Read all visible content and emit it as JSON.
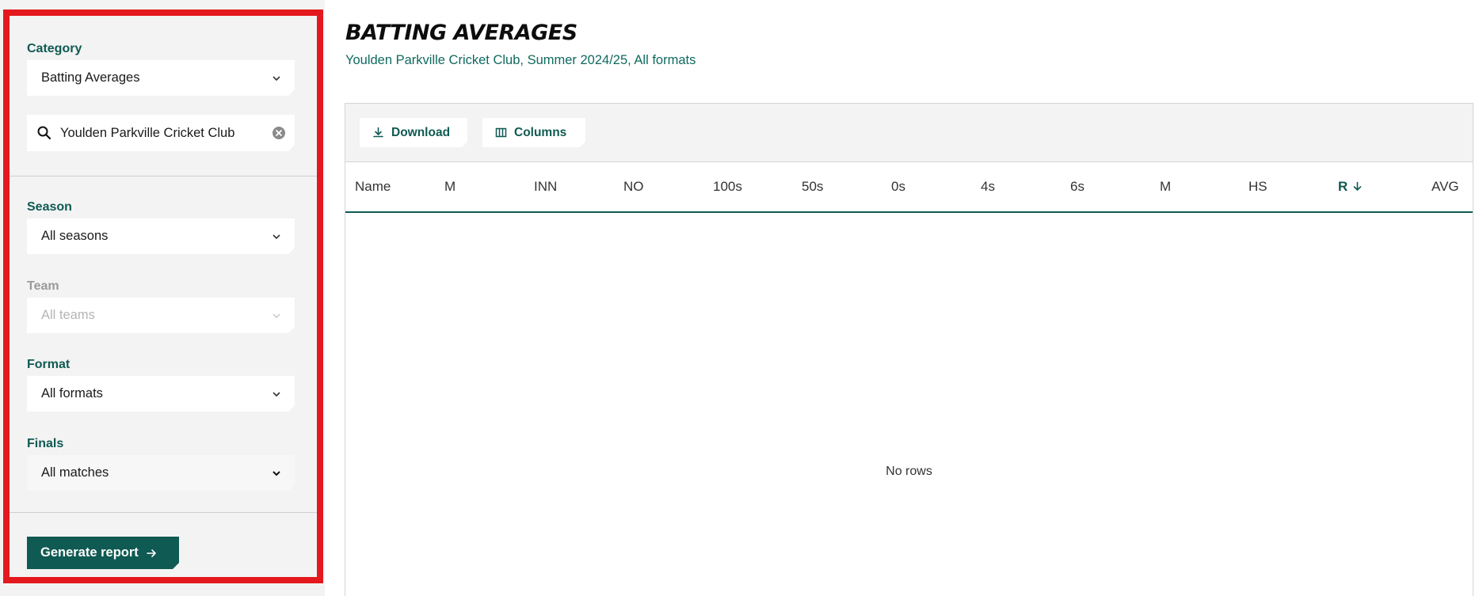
{
  "sidebar": {
    "category": {
      "label": "Category",
      "value": "Batting Averages"
    },
    "search": {
      "value": "Youlden Parkville Cricket Club",
      "placeholder": ""
    },
    "season": {
      "label": "Season",
      "value": "All seasons"
    },
    "team": {
      "label": "Team",
      "value": "All teams"
    },
    "format": {
      "label": "Format",
      "value": "All formats"
    },
    "finals": {
      "label": "Finals",
      "value": "All matches"
    },
    "generate_label": "Generate report"
  },
  "main": {
    "title": "BATTING AVERAGES",
    "subtitle": "Youlden Parkville Cricket Club, Summer 2024/25, All formats",
    "toolbar": {
      "download_label": "Download",
      "columns_label": "Columns"
    },
    "columns": [
      "Name",
      "M",
      "INN",
      "NO",
      "100s",
      "50s",
      "0s",
      "4s",
      "6s",
      "M",
      "HS",
      "R",
      "AVG"
    ],
    "sorted_column": "R",
    "empty_text": "No rows"
  },
  "colors": {
    "accent": "#0f5a52",
    "highlight_border": "#e3191d",
    "sidebar_bg": "#f3f3f3"
  },
  "icons": {
    "chevron": "chevron-down-icon",
    "search": "search-icon",
    "clear": "clear-icon",
    "download": "download-icon",
    "columns": "columns-icon",
    "arrow": "arrow-right-icon",
    "sort": "arrow-down-icon"
  }
}
